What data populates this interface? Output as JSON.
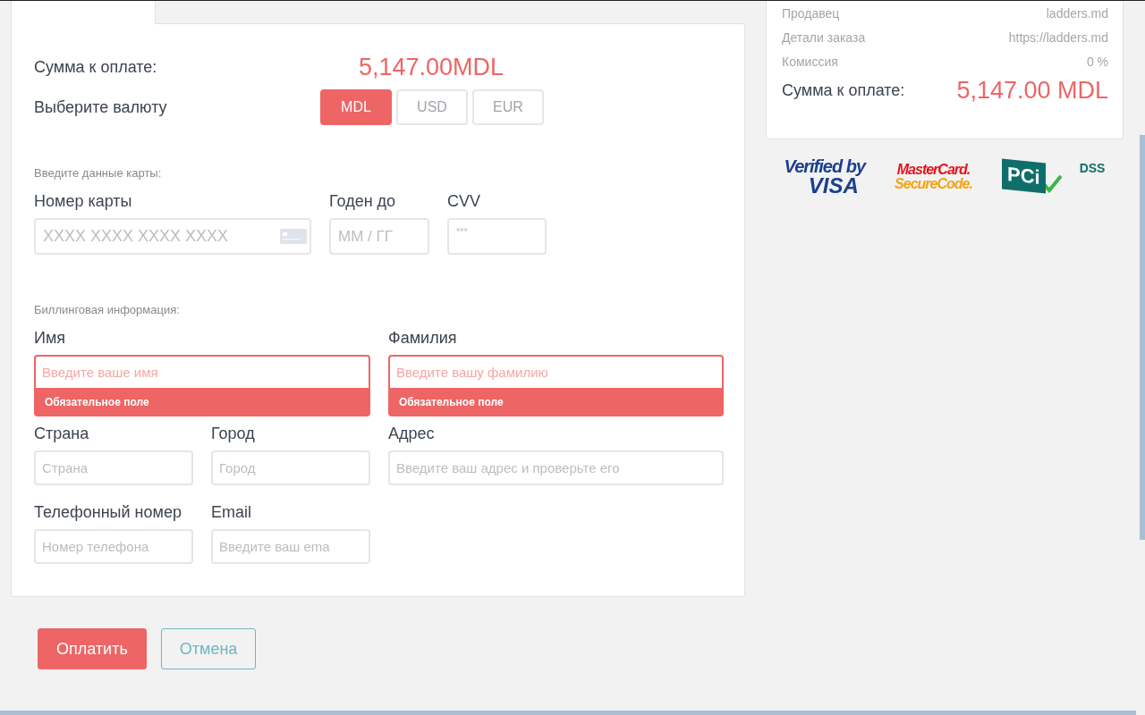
{
  "payment_form": {
    "amount": {
      "label": "Сумма к оплате:",
      "value": "5,147.00MDL"
    },
    "currency": {
      "label": "Выберите валюту",
      "options": [
        {
          "label": "MDL",
          "selected": true
        },
        {
          "label": "USD",
          "selected": false
        },
        {
          "label": "EUR",
          "selected": false
        }
      ]
    },
    "card_section": {
      "title": "Введите данные карты:",
      "fields": [
        {
          "kind": "card_number",
          "label": "Номер карты",
          "placeholder": "XXXX XXXX XXXX XXXX"
        },
        {
          "kind": "text",
          "label": "Годен до",
          "placeholder": "ММ / ГГ"
        },
        {
          "kind": "secret",
          "label": "CVV",
          "placeholder": "***"
        }
      ]
    },
    "billing": {
      "title": "Биллинговая информация:",
      "fields": [
        {
          "label": "Имя",
          "placeholder": "Введите ваше имя",
          "invalid": true,
          "error": "Обязательное поле"
        },
        {
          "label": "Фамилия",
          "placeholder": "Введите вашу фамилию",
          "invalid": true,
          "error": "Обязательное поле"
        },
        {
          "label": "Страна",
          "placeholder": "Страна",
          "invalid": false
        },
        {
          "label": "Город",
          "placeholder": "Город",
          "invalid": false
        },
        {
          "label": "Адрес",
          "placeholder": "Введите ваш адрес и проверьте его",
          "invalid": false
        },
        {
          "label": "Телефонный номер",
          "placeholder": "Номер телефона",
          "invalid": false
        },
        {
          "label": "Email",
          "placeholder": "Введите ваш ema",
          "invalid": false
        }
      ]
    }
  },
  "actions": [
    {
      "kind": "primary",
      "label": "Оплатить"
    },
    {
      "kind": "secondary",
      "label": "Отмена"
    }
  ],
  "summary": {
    "rows": [
      {
        "label": "Продавец",
        "value": "ladders.md"
      },
      {
        "label": "Детали заказа",
        "value": "https://ladders.md"
      },
      {
        "label": "Комиссия",
        "value": "0 %"
      }
    ],
    "total": {
      "label": "Сумма к оплате:",
      "value": "5,147.00 MDL"
    }
  },
  "logos": [
    {
      "kind": "visa",
      "lines": [
        "Verified by",
        "VISA"
      ]
    },
    {
      "kind": "mastercard",
      "lines": [
        "MasterCard.",
        "SecureCode."
      ]
    },
    {
      "kind": "pci",
      "lines": [
        "PCi",
        "DSS"
      ]
    }
  ]
}
